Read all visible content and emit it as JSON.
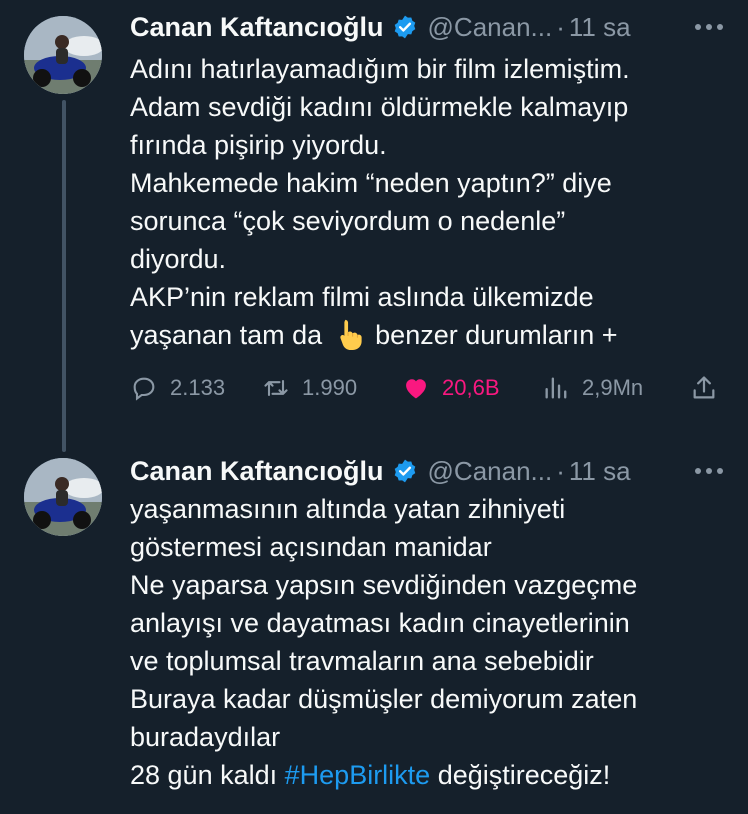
{
  "tweets": [
    {
      "author_name": "Canan Kaftancıoğlu",
      "handle": "@Canan...",
      "separator": "·",
      "time": "11 sa",
      "lines": [
        "Adını hatırlayamadığım bir film izlemiştim.",
        "Adam sevdiği kadını öldürmekle kalmayıp",
        "fırında pişirip yiyordu.",
        "Mahkemede hakim “neden yaptın?” diye",
        "sorunca “çok seviyordum o nedenle”",
        "diyordu.",
        "AKP’nin reklam filmi aslında ülkemizde"
      ],
      "last_line_before_emoji": "yaşanan tam da",
      "last_line_after_emoji": "benzer durumların +",
      "emoji": "pointing-down-hand-emoji",
      "stats": {
        "replies": "2.133",
        "reposts": "1.990",
        "likes": "20,6B",
        "views": "2,9Mn"
      }
    },
    {
      "author_name": "Canan Kaftancıoğlu",
      "handle": "@Canan...",
      "separator": "·",
      "time": "11 sa",
      "lines": [
        "yaşanmasının altında yatan zihniyeti",
        "göstermesi açısından manidar",
        "Ne yaparsa yapsın sevdiğinden vazgeçme",
        "anlayışı ve dayatması kadın cinayetlerinin",
        "ve toplumsal travmaların ana sebebidir",
        "Buraya kadar düşmüşler demiyorum zaten",
        "buradaydılar"
      ],
      "final_prefix": "28 gün kaldı",
      "hashtag": "#HepBirlikte",
      "final_suffix": "değiştireceğiz!"
    }
  ],
  "colors": {
    "background": "#15202b",
    "text": "#f7f9f9",
    "muted": "#8b98a5",
    "link": "#1d9bf0",
    "like": "#f91880",
    "verified": "#1d9bf0"
  },
  "icons": [
    "verified-badge-icon",
    "more-options-icon",
    "reply-icon",
    "repost-icon",
    "like-heart-icon",
    "views-icon",
    "share-icon"
  ]
}
